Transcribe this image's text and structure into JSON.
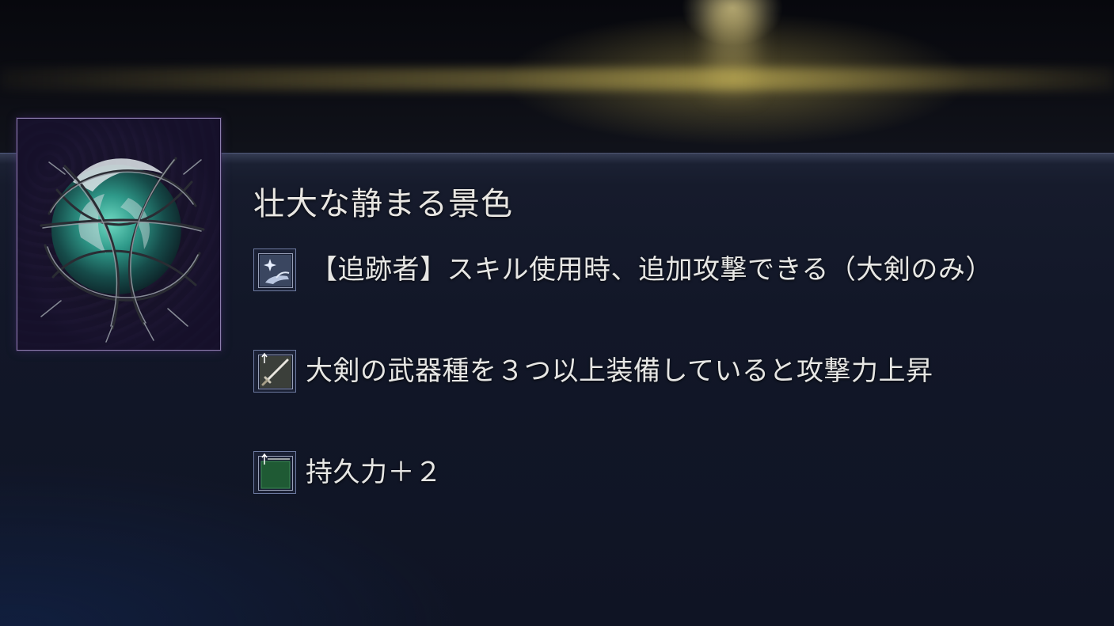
{
  "relic": {
    "name": "壮大な静まる景色",
    "image_icon": "dark-green-orb-entwined-branches-icon",
    "frame_color": "#8d7fae"
  },
  "effects": [
    {
      "icon": "skill-sparkle-hand-icon",
      "text": "【追跡者】スキル使用時、追加攻撃できる（大剣のみ）"
    },
    {
      "icon": "greatsword-up-arrow-icon",
      "text": "大剣の武器種を３つ以上装備していると攻撃力上昇"
    },
    {
      "icon": "green-stamina-up-arrow-icon",
      "text": "持久力＋２"
    }
  ],
  "colors": {
    "accent_gold": "#cbb45a",
    "panel_bg": "#121728",
    "text": "#e6e6e4",
    "icon_border": "#6d7aa0"
  }
}
